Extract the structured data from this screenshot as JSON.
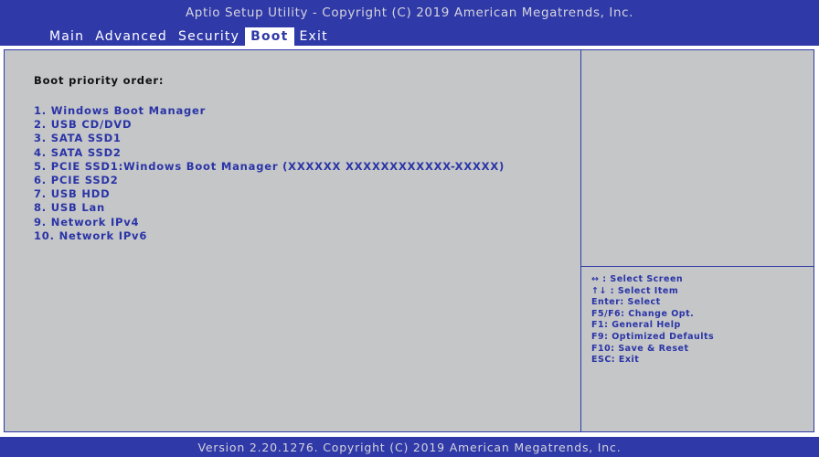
{
  "header": {
    "title": "Aptio Setup Utility - Copyright (C) 2019 American Megatrends, Inc."
  },
  "tabs": [
    {
      "label": "Main",
      "active": false
    },
    {
      "label": "Advanced",
      "active": false
    },
    {
      "label": "Security",
      "active": false
    },
    {
      "label": "Boot",
      "active": true
    },
    {
      "label": "Exit",
      "active": false
    }
  ],
  "main": {
    "heading": "Boot priority order:",
    "boot_items": [
      "1. Windows Boot Manager",
      "2. USB CD/DVD",
      "3. SATA SSD1",
      "4. SATA SSD2",
      "5. PCIE SSD1:Windows Boot Manager (XXXXXX XXXXXXXXXXXX-XXXXX)",
      "6. PCIE SSD2",
      "7. USB HDD",
      "8. USB Lan",
      "9. Network IPv4",
      "10. Network IPv6"
    ]
  },
  "help": [
    "↔ : Select Screen",
    "↑↓ : Select Item",
    "Enter: Select",
    "F5/F6: Change Opt.",
    "F1: General Help",
    "F9: Optimized Defaults",
    "F10: Save & Reset",
    "ESC: Exit"
  ],
  "footer": {
    "text": "Version 2.20.1276. Copyright (C) 2019 American Megatrends, Inc."
  },
  "colors": {
    "header_blue": "#2f39a8",
    "panel_gray": "#c4c6c8",
    "item_text_blue": "#2a34a6",
    "title_text": "#d4d4dc"
  }
}
